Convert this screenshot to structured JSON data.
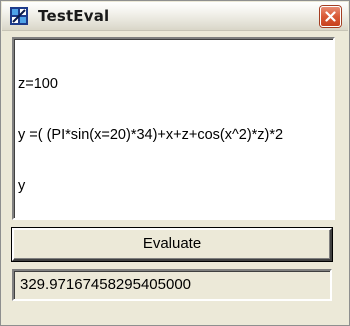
{
  "window": {
    "title": "TestEval"
  },
  "editor": {
    "lines": [
      "z=100",
      "y =( (PI*sin(x=20)*34)+x+z+cos(x^2)*z)*2",
      "y"
    ]
  },
  "evaluate_button": {
    "label": "Evaluate"
  },
  "result": {
    "value": "329.97167458295405000"
  },
  "icons": {
    "app": "app-icon",
    "close": "close-icon"
  },
  "colors": {
    "close_button": "#d95a37",
    "face": "#ece9d8",
    "editor_bg": "#ffffff"
  }
}
